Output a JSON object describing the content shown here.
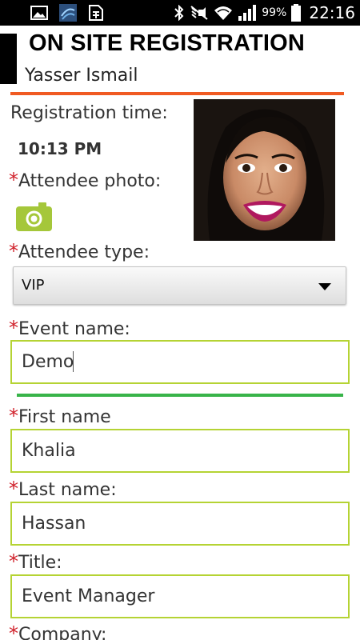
{
  "status_bar": {
    "battery_text": "99%",
    "time": "22:16",
    "icons": [
      "image-icon",
      "app-icon",
      "sim-icon",
      "bluetooth-icon",
      "mute-icon",
      "wifi-icon",
      "signal-icon",
      "battery-icon"
    ]
  },
  "header": {
    "title": "ON SITE REGISTRATION",
    "user_name": "Yasser Ismail"
  },
  "registration": {
    "time_label": "Registration time:",
    "time_value": "10:13 PM"
  },
  "photo": {
    "label": "Attendee photo:",
    "camera_icon": "camera-icon"
  },
  "attendee_type": {
    "label": "Attendee type:",
    "selected": "VIP"
  },
  "fields": {
    "event_name": {
      "label": "Event name:",
      "value": "Demo"
    },
    "first_name": {
      "label": "First name",
      "value": "Khalia"
    },
    "last_name": {
      "label": "Last name:",
      "value": "Hassan"
    },
    "title": {
      "label": "Title:",
      "value": "Event Manager"
    },
    "company": {
      "label": "Company:"
    }
  },
  "required_marker": "*",
  "colors": {
    "accent_orange": "#f05a22",
    "accent_green": "#38b449",
    "input_border": "#b5d334",
    "camera_green": "#a5c73a",
    "required_red": "#d0202a"
  }
}
